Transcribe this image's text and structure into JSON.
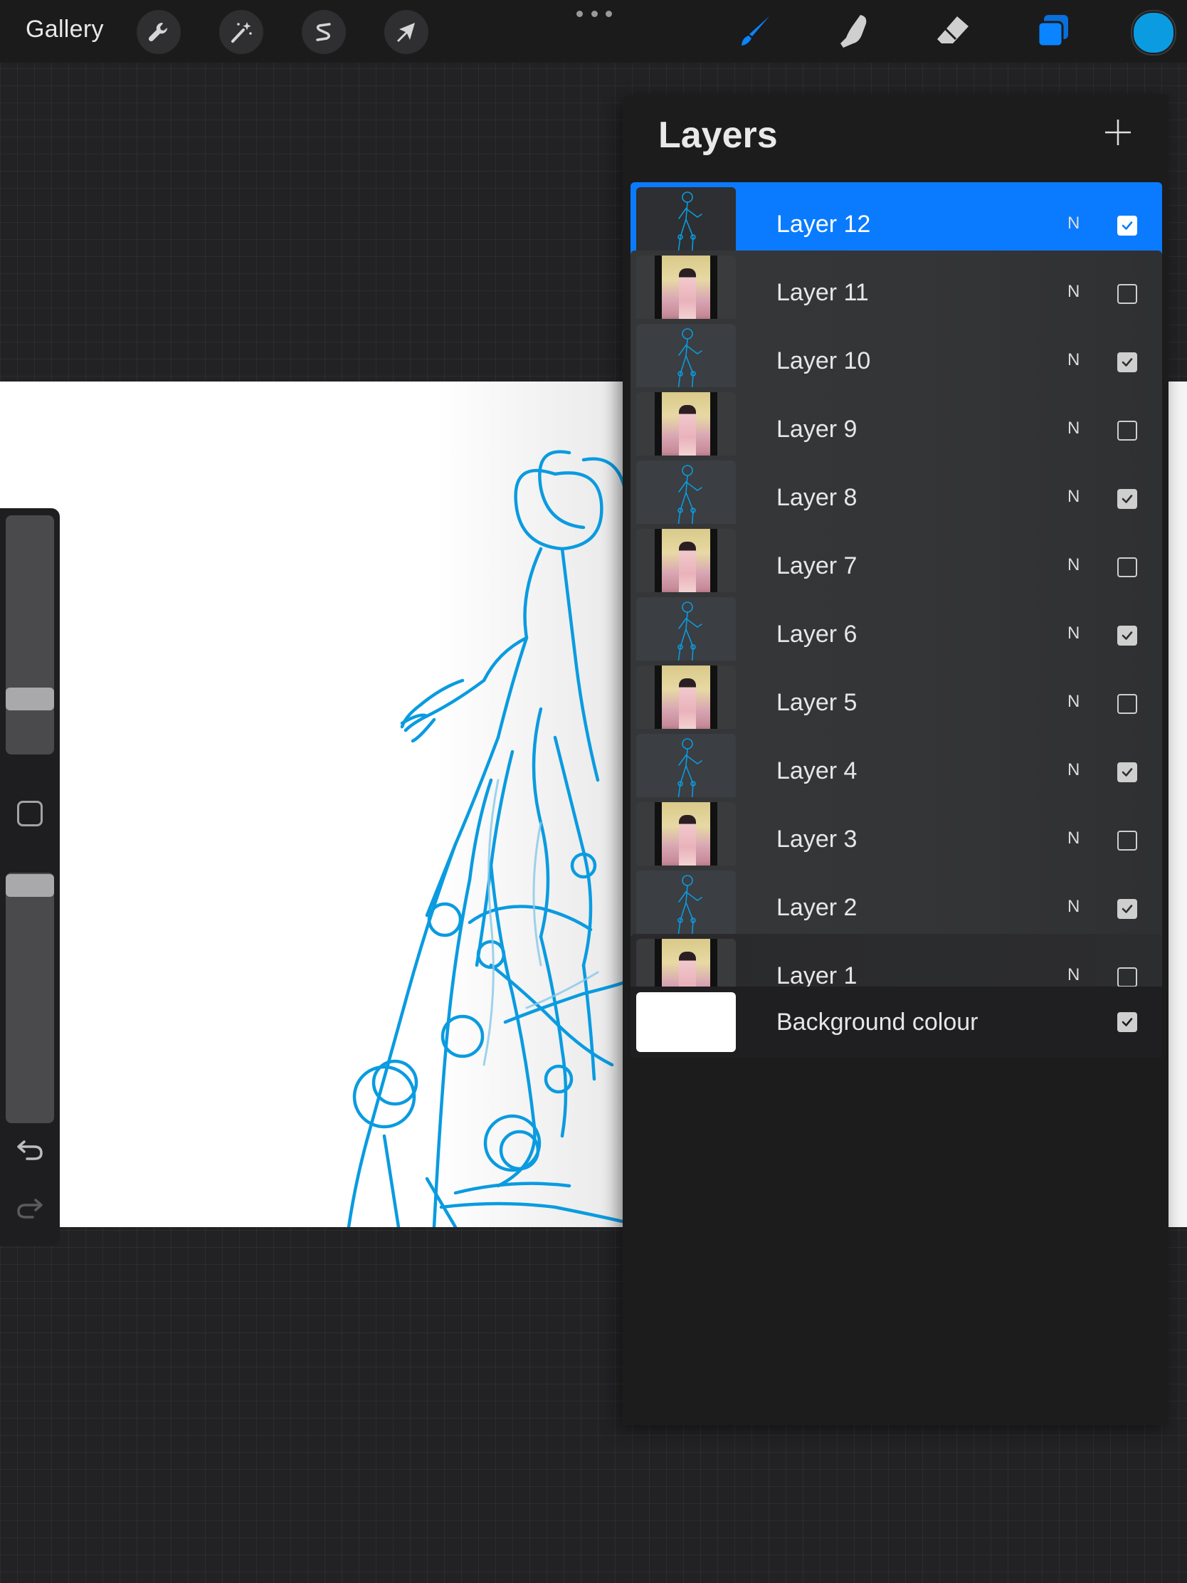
{
  "toolbar": {
    "gallery_label": "Gallery",
    "left_tools": [
      {
        "name": "actions",
        "icon": "wrench-icon"
      },
      {
        "name": "adjustments",
        "icon": "magic-wand-icon"
      },
      {
        "name": "selection",
        "icon": "selection-s-icon"
      },
      {
        "name": "transform",
        "icon": "arrow-cursor-icon"
      }
    ],
    "right_tools": [
      {
        "name": "brush",
        "icon": "brush-icon",
        "active": true
      },
      {
        "name": "smudge",
        "icon": "smudge-finger-icon"
      },
      {
        "name": "eraser",
        "icon": "eraser-icon"
      },
      {
        "name": "layers",
        "icon": "layers-icon",
        "active": true
      }
    ],
    "current_color": "#0a9be0",
    "accent_color": "#0a7bff"
  },
  "layers": {
    "title": "Layers",
    "add_icon": "plus-icon",
    "items": [
      {
        "name": "Layer 12",
        "mode": "N",
        "visible": true,
        "selected": true,
        "thumb": "sketch"
      },
      {
        "name": "Layer 11",
        "mode": "N",
        "visible": false,
        "selected": false,
        "thumb": "photo"
      },
      {
        "name": "Layer 10",
        "mode": "N",
        "visible": true,
        "selected": false,
        "thumb": "sketch"
      },
      {
        "name": "Layer 9",
        "mode": "N",
        "visible": false,
        "selected": false,
        "thumb": "photo"
      },
      {
        "name": "Layer 8",
        "mode": "N",
        "visible": true,
        "selected": false,
        "thumb": "sketch"
      },
      {
        "name": "Layer 7",
        "mode": "N",
        "visible": false,
        "selected": false,
        "thumb": "photo"
      },
      {
        "name": "Layer 6",
        "mode": "N",
        "visible": true,
        "selected": false,
        "thumb": "sketch"
      },
      {
        "name": "Layer 5",
        "mode": "N",
        "visible": false,
        "selected": false,
        "thumb": "photo"
      },
      {
        "name": "Layer 4",
        "mode": "N",
        "visible": true,
        "selected": false,
        "thumb": "sketch"
      },
      {
        "name": "Layer 3",
        "mode": "N",
        "visible": false,
        "selected": false,
        "thumb": "photo"
      },
      {
        "name": "Layer 2",
        "mode": "N",
        "visible": true,
        "selected": false,
        "thumb": "sketch"
      },
      {
        "name": "Layer 1",
        "mode": "N",
        "visible": false,
        "selected": false,
        "thumb": "photo"
      }
    ],
    "background": {
      "name": "Background colour",
      "visible": true,
      "color": "#ffffff"
    }
  },
  "sidebar": {
    "brush_size_level": 0.3,
    "opacity_level": 1.0
  }
}
